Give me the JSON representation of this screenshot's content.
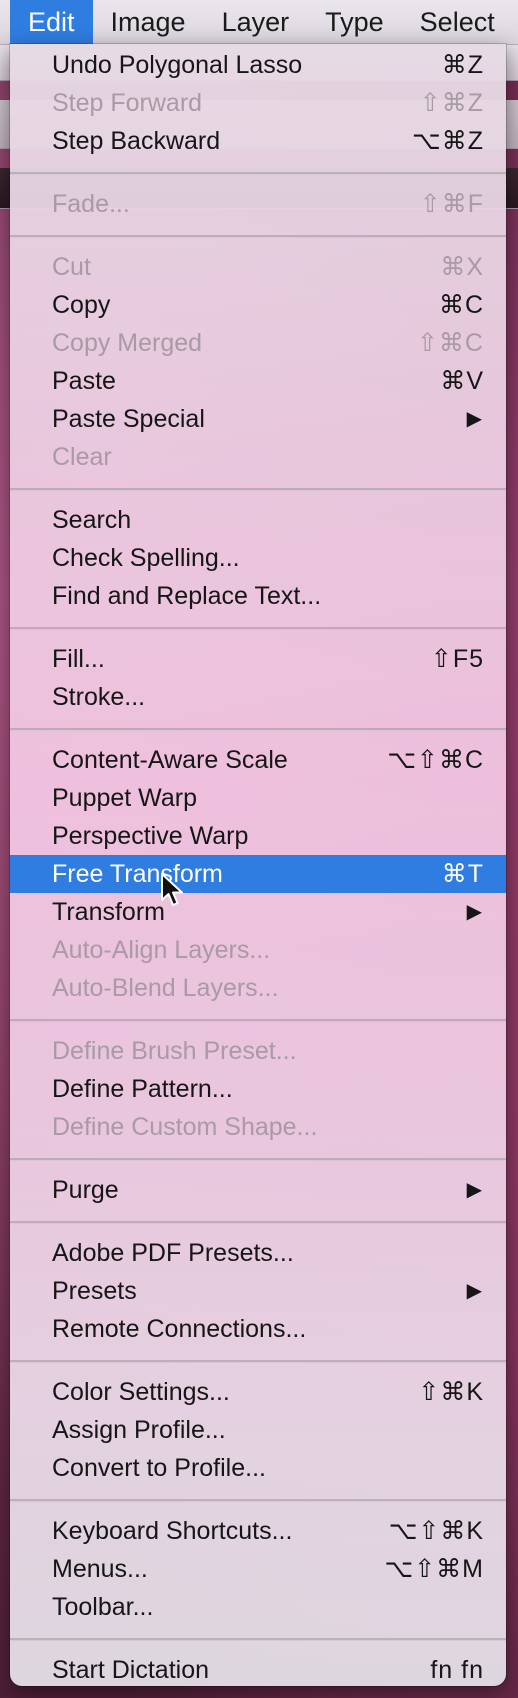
{
  "menubar": {
    "items": [
      "Edit",
      "Image",
      "Layer",
      "Type",
      "Select"
    ]
  },
  "colors": {
    "highlight": "#2f7de1",
    "disabled_text": "#a99aa5"
  },
  "menu": {
    "undo": {
      "label": "Undo Polygonal Lasso",
      "shortcut": "⌘Z"
    },
    "step_forward": {
      "label": "Step Forward",
      "shortcut": "⇧⌘Z"
    },
    "step_backward": {
      "label": "Step Backward",
      "shortcut": "⌥⌘Z"
    },
    "fade": {
      "label": "Fade...",
      "shortcut": "⇧⌘F"
    },
    "cut": {
      "label": "Cut",
      "shortcut": "⌘X"
    },
    "copy": {
      "label": "Copy",
      "shortcut": "⌘C"
    },
    "copy_merged": {
      "label": "Copy Merged",
      "shortcut": "⇧⌘C"
    },
    "paste": {
      "label": "Paste",
      "shortcut": "⌘V"
    },
    "paste_special": {
      "label": "Paste Special",
      "arrow": "▶"
    },
    "clear": {
      "label": "Clear"
    },
    "search": {
      "label": "Search"
    },
    "check_spelling": {
      "label": "Check Spelling..."
    },
    "find_replace": {
      "label": "Find and Replace Text..."
    },
    "fill": {
      "label": "Fill...",
      "shortcut": "⇧F5"
    },
    "stroke": {
      "label": "Stroke..."
    },
    "content_aware_scale": {
      "label": "Content-Aware Scale",
      "shortcut": "⌥⇧⌘C"
    },
    "puppet_warp": {
      "label": "Puppet Warp"
    },
    "perspective_warp": {
      "label": "Perspective Warp"
    },
    "free_transform": {
      "label": "Free Transform",
      "shortcut": "⌘T"
    },
    "transform": {
      "label": "Transform",
      "arrow": "▶"
    },
    "auto_align": {
      "label": "Auto-Align Layers..."
    },
    "auto_blend": {
      "label": "Auto-Blend Layers..."
    },
    "define_brush": {
      "label": "Define Brush Preset..."
    },
    "define_pattern": {
      "label": "Define Pattern..."
    },
    "define_shape": {
      "label": "Define Custom Shape..."
    },
    "purge": {
      "label": "Purge",
      "arrow": "▶"
    },
    "pdf_presets": {
      "label": "Adobe PDF Presets..."
    },
    "presets": {
      "label": "Presets",
      "arrow": "▶"
    },
    "remote_connections": {
      "label": "Remote Connections..."
    },
    "color_settings": {
      "label": "Color Settings...",
      "shortcut": "⇧⌘K"
    },
    "assign_profile": {
      "label": "Assign Profile..."
    },
    "convert_profile": {
      "label": "Convert to Profile..."
    },
    "keyboard_shortcuts": {
      "label": "Keyboard Shortcuts...",
      "shortcut": "⌥⇧⌘K"
    },
    "menus": {
      "label": "Menus...",
      "shortcut": "⌥⇧⌘M"
    },
    "toolbar": {
      "label": "Toolbar..."
    },
    "start_dictation": {
      "label": "Start Dictation",
      "shortcut": "fn fn"
    }
  }
}
